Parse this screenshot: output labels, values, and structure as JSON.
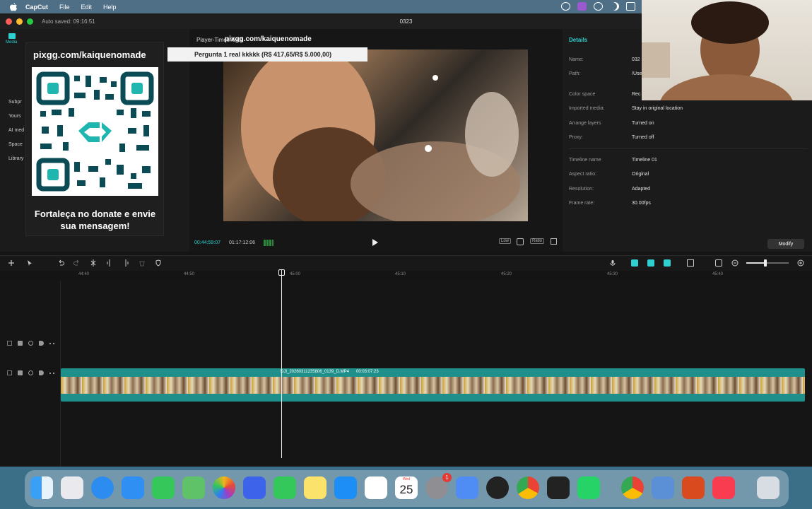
{
  "menubar": {
    "app_name": "CapCut",
    "items": [
      "File",
      "Edit",
      "Help"
    ]
  },
  "window": {
    "autosave": "Auto saved: 09:16:51",
    "title": "0323"
  },
  "left_panel": {
    "tab_media": "Media",
    "nav": [
      "Subpr",
      "Yours",
      "AI med",
      "Space",
      "Library"
    ]
  },
  "qr_card": {
    "url": "pixgg.com/kaiquenomade",
    "message": "Fortaleça no donate e envie sua mensagem!"
  },
  "player": {
    "title": "Player-Timeline 01",
    "overlay_url": "pixgg.com/kaiquenomade",
    "donation_banner": "Pergunta 1 real kkkkk (R$ 417,65/R$ 5.000,00)",
    "current_time": "00:44:59:07",
    "total_time": "01:17:12:06",
    "ctrl_low": "Low",
    "ctrl_ratio": "Ratio"
  },
  "details": {
    "title": "Details",
    "rows": [
      {
        "label": "Name:",
        "value": "032"
      },
      {
        "label": "Path:",
        "value": "/Use"
      },
      {
        "label": "Color space",
        "value": "Rec"
      },
      {
        "label": "Imported media:",
        "value": "Stay in original location"
      },
      {
        "label": "Arrange layers",
        "value": "Turned on"
      },
      {
        "label": "Proxy:",
        "value": "Turned off"
      },
      {
        "label": "Timeline name",
        "value": "Timeline 01"
      },
      {
        "label": "Aspect ratio:",
        "value": "Original"
      },
      {
        "label": "Resolution:",
        "value": "Adapted"
      },
      {
        "label": "Frame rate:",
        "value": "30.00fps"
      }
    ],
    "modify_label": "Modify"
  },
  "timeline": {
    "ruler": [
      "44:40",
      "44:50",
      "45:00",
      "45:10",
      "45:20",
      "45:30",
      "45:40"
    ],
    "clip_name": "DJI_20260311235806_0139_D.MP4",
    "clip_length": "00:03:07:23"
  },
  "dock": {
    "calendar_day": "Wed",
    "calendar_date": "25",
    "settings_badge": "1",
    "apps": [
      "finder-icon",
      "launchpad-icon",
      "safari-icon",
      "mail-icon",
      "messages-icon",
      "maps-icon",
      "photos-icon",
      "nordvpn-icon",
      "facetime-icon",
      "notes-icon",
      "app-store-icon",
      "capcut-icon",
      "calendar-icon",
      "system-settings-icon",
      "simulator-icon",
      "obs-icon",
      "chrome-icon",
      "davinci-resolve-icon",
      "whatsapp-icon",
      "chrome-icon",
      "finder-alt-icon",
      "filezilla-icon",
      "music-icon",
      "trash-icon"
    ]
  }
}
